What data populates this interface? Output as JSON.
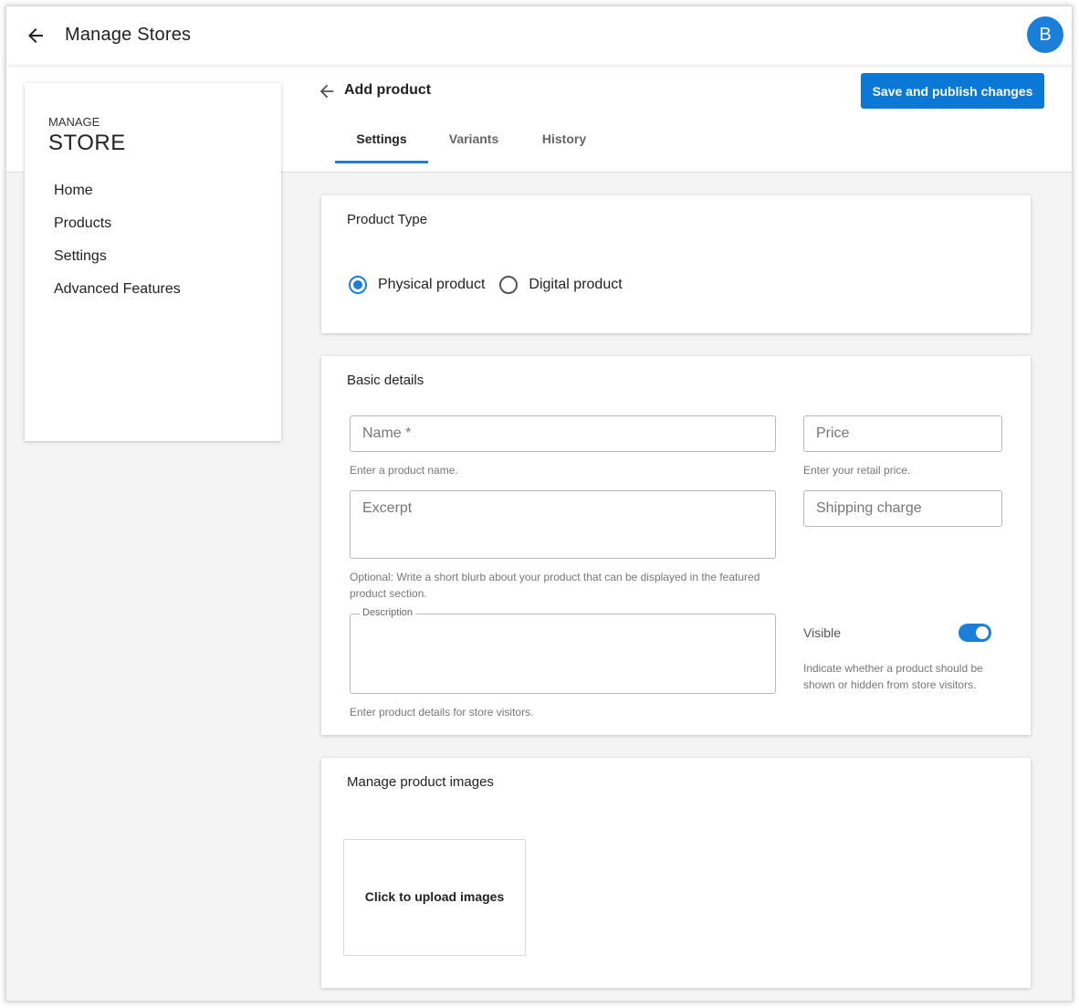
{
  "appbar": {
    "title": "Manage Stores",
    "back_icon": "arrow-left-icon",
    "avatar_initial": "B"
  },
  "sidebar": {
    "eyebrow": "MANAGE",
    "title": "STORE",
    "items": [
      {
        "label": "Home"
      },
      {
        "label": "Products"
      },
      {
        "label": "Settings"
      },
      {
        "label": "Advanced Features"
      }
    ]
  },
  "page": {
    "title": "Add product",
    "back_icon": "arrow-left-icon",
    "save_label": "Save and publish changes"
  },
  "tabs": [
    {
      "label": "Settings",
      "active": true
    },
    {
      "label": "Variants"
    },
    {
      "label": "History"
    }
  ],
  "product_type": {
    "title": "Product Type",
    "options": [
      {
        "label": "Physical product",
        "checked": true
      },
      {
        "label": "Digital product",
        "checked": false
      }
    ]
  },
  "basic_details": {
    "title": "Basic details",
    "name": {
      "placeholder": "Name *",
      "value": "",
      "helper": "Enter a product name."
    },
    "price": {
      "placeholder": "Price",
      "value": "",
      "helper": "Enter your retail price."
    },
    "excerpt": {
      "placeholder": "Excerpt",
      "value": "",
      "helper": "Optional: Write a short blurb about your product that can be displayed in the featured product section."
    },
    "shipping": {
      "placeholder": "Shipping charge",
      "value": ""
    },
    "description": {
      "label": "Description",
      "value": "",
      "helper": "Enter product details for store visitors."
    },
    "visible": {
      "label": "Visible",
      "on": true,
      "helper": "Indicate whether a product should be shown or hidden from store visitors."
    }
  },
  "images": {
    "title": "Manage product images",
    "upload_label": "Click to upload images"
  },
  "colors": {
    "accent": "#1a7fd8",
    "button": "#0a78d6",
    "background": "#f4f4f4"
  }
}
